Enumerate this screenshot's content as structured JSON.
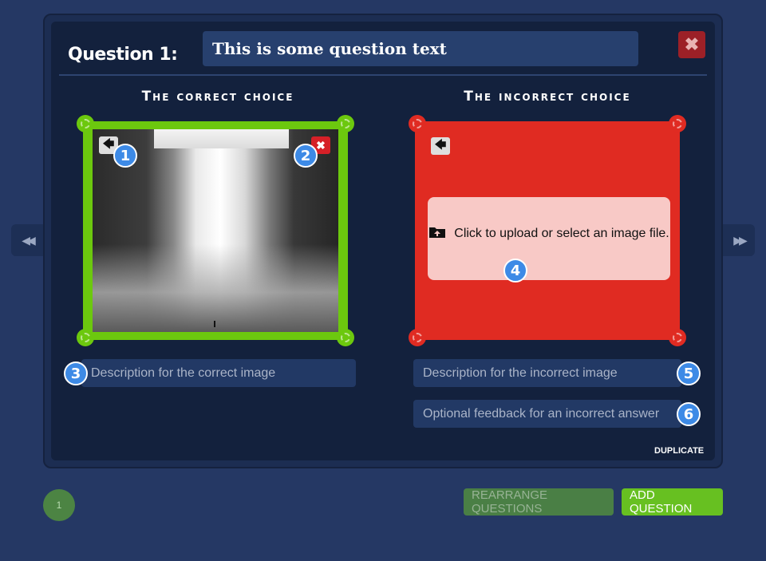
{
  "question": {
    "label": "Question 1:",
    "text": "This is some question text",
    "close_glyph": "✖"
  },
  "correct": {
    "title": "The correct choice",
    "color": "#6cc80e",
    "back_glyph": "🡄",
    "remove_glyph": "✖",
    "description_placeholder": "Description for the correct image",
    "badges": [
      "1",
      "2",
      "3"
    ]
  },
  "incorrect": {
    "title": "The incorrect choice",
    "color": "#e02b22",
    "back_glyph": "🡄",
    "upload_text": "Click to upload or select an image file.",
    "description_placeholder": "Description for the incorrect image",
    "feedback_placeholder": "Optional feedback for an incorrect answer",
    "badges": [
      "4",
      "5",
      "6"
    ]
  },
  "actions": {
    "duplicate": "DUPLICATE",
    "rearrange": "REARRANGE QUESTIONS",
    "add": "ADD QUESTION"
  },
  "nav": {
    "prev_glyph": "◀◀",
    "next_glyph": "▶▶",
    "page": "1"
  },
  "icons": {
    "close": "close-icon",
    "back": "arrow-left-icon",
    "remove_image": "close-icon",
    "upload": "folder-upload-icon",
    "prev": "double-chevron-left-icon",
    "next": "double-chevron-right-icon"
  }
}
